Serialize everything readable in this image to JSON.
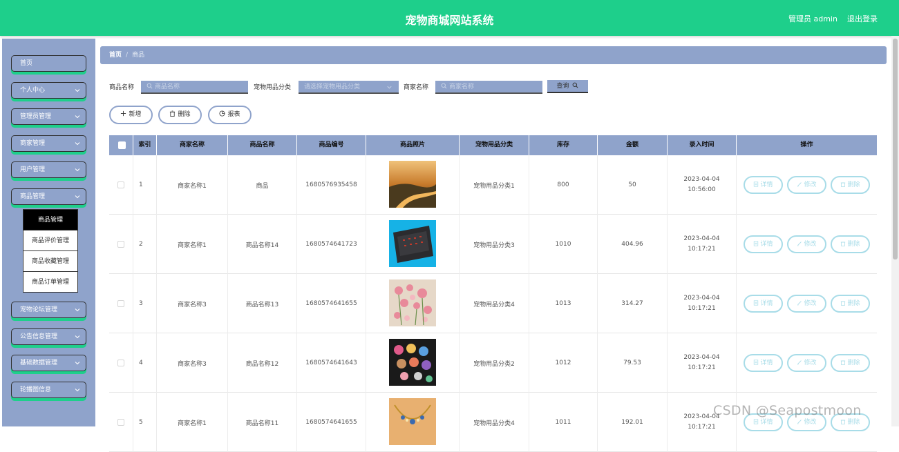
{
  "header": {
    "title": "宠物商城网站系统",
    "admin": "管理员 admin",
    "logout": "退出登录"
  },
  "sidebar": {
    "items": [
      {
        "label": "首页",
        "has_arrow": false
      },
      {
        "label": "个人中心",
        "has_arrow": true
      },
      {
        "label": "管理员管理",
        "has_arrow": true
      },
      {
        "label": "商家管理",
        "has_arrow": true
      },
      {
        "label": "用户管理",
        "has_arrow": true
      },
      {
        "label": "商品管理",
        "has_arrow": true
      },
      {
        "label": "宠物论坛管理",
        "has_arrow": true
      },
      {
        "label": "公告信息管理",
        "has_arrow": true
      },
      {
        "label": "基础数据管理",
        "has_arrow": true
      },
      {
        "label": "轮播图信息",
        "has_arrow": true
      }
    ],
    "submenu": [
      "商品管理",
      "商品评价管理",
      "商品收藏管理",
      "商品订单管理"
    ],
    "active_submenu": "商品管理"
  },
  "breadcrumb": {
    "home": "首页",
    "sep": "/",
    "current": "商品"
  },
  "filters": {
    "name_label": "商品名称",
    "name_placeholder": "商品名称",
    "category_label": "宠物用品分类",
    "category_placeholder": "请选择宠物用品分类",
    "merchant_label": "商家名称",
    "merchant_placeholder": "商家名称",
    "query_label": "查询"
  },
  "actions": {
    "add": "新增",
    "delete": "删除",
    "report": "报表"
  },
  "table": {
    "headers": [
      "索引",
      "商家名称",
      "商品名称",
      "商品编号",
      "商品照片",
      "宠物用品分类",
      "库存",
      "金额",
      "录入时间",
      "操作"
    ],
    "op_labels": {
      "detail": "详情",
      "edit": "修改",
      "delete": "删除"
    },
    "rows": [
      {
        "index": "1",
        "merchant": "商家名称1",
        "name": "商品",
        "code": "1680576935458",
        "category": "宠物用品分类1",
        "stock": "800",
        "amount": "50",
        "time": "2023-04-04 10:56:00",
        "photo": "river-sunset"
      },
      {
        "index": "2",
        "merchant": "商家名称1",
        "name": "商品名称14",
        "code": "1680574641723",
        "category": "宠物用品分类3",
        "stock": "1010",
        "amount": "404.96",
        "time": "2023-04-04 10:17:21",
        "photo": "laptop-keyboard"
      },
      {
        "index": "3",
        "merchant": "商家名称3",
        "name": "商品名称13",
        "code": "1680574641655",
        "category": "宠物用品分类4",
        "stock": "1013",
        "amount": "314.27",
        "time": "2023-04-04 10:17:21",
        "photo": "flowers"
      },
      {
        "index": "4",
        "merchant": "商家名称3",
        "name": "商品名称12",
        "code": "1680574641643",
        "category": "宠物用品分类2",
        "stock": "1012",
        "amount": "79.53",
        "time": "2023-04-04 10:17:21",
        "photo": "makeup-palette"
      },
      {
        "index": "5",
        "merchant": "商家名称1",
        "name": "商品名称11",
        "code": "1680574641655",
        "category": "宠物用品分类4",
        "stock": "1011",
        "amount": "192.01",
        "time": "2023-04-04 10:17:21",
        "photo": "necklace"
      }
    ]
  },
  "watermark": "CSDN @Seapostmoon",
  "colors": {
    "header": "#1ecf8b",
    "sidebar": "#8fa3cb",
    "op_button": "#a8dce8"
  }
}
